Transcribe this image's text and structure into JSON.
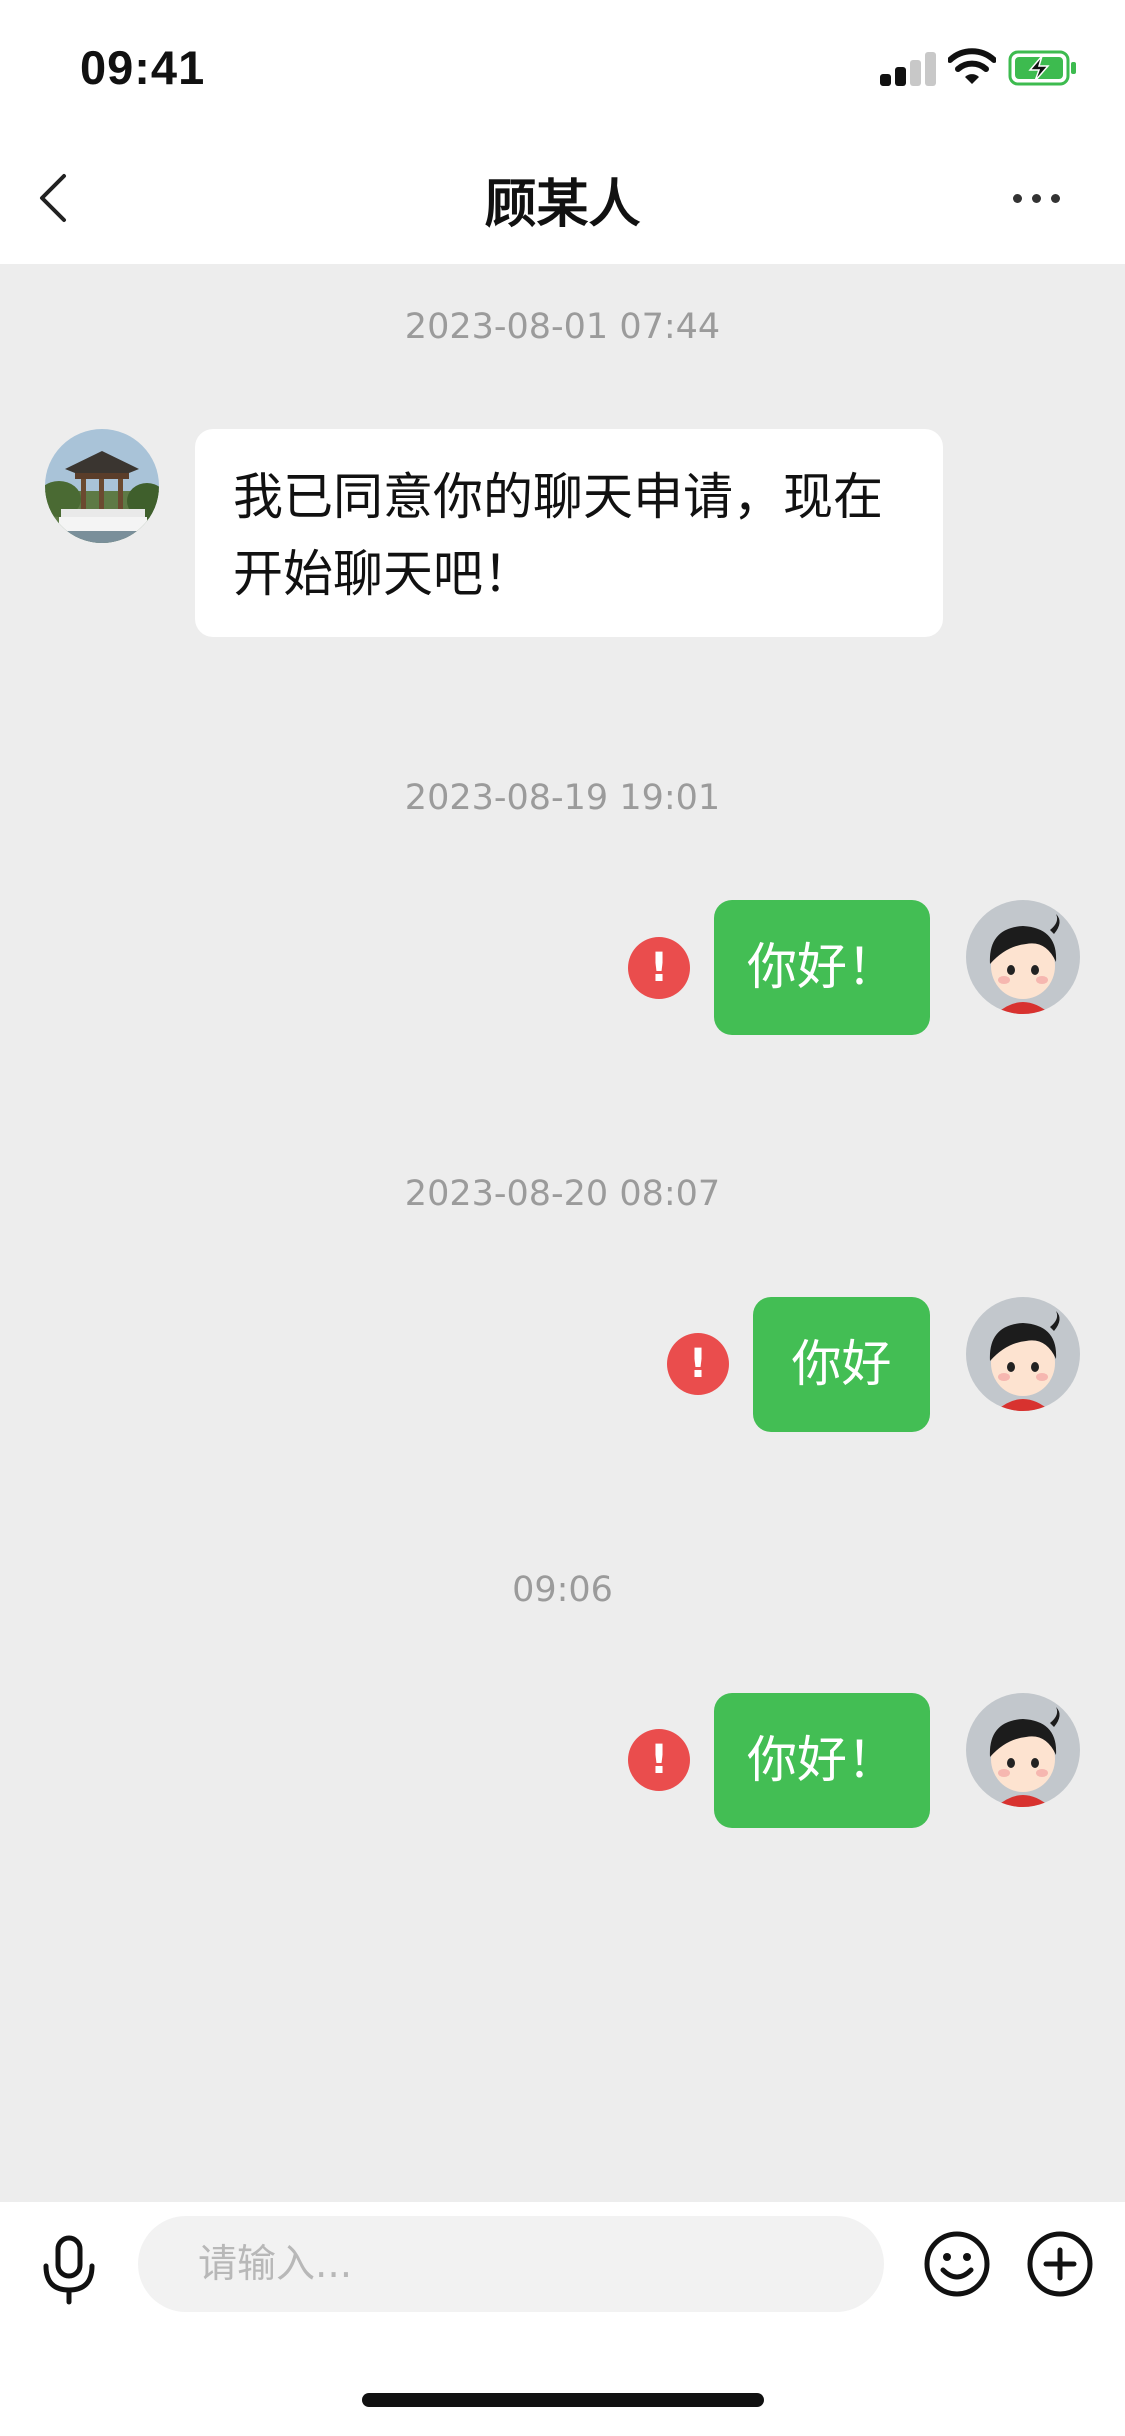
{
  "status_bar": {
    "time": "09:41",
    "battery_color": "#3dbb4f"
  },
  "nav": {
    "title": "顾某人"
  },
  "colors": {
    "sent_bubble": "#43be54",
    "error": "#ea4d4d",
    "background": "#ededed"
  },
  "messages": [
    {
      "timestamp": "2023-08-01 07:44",
      "from": "contact",
      "text": "我已同意你的聊天申请，现在开始聊天吧！",
      "text_line1": "我已同意你的聊天申请，现在",
      "text_line2": "开始聊天吧！"
    },
    {
      "timestamp": "2023-08-19 19:01",
      "from": "me",
      "text": "你好！",
      "send_failed": true
    },
    {
      "timestamp": "2023-08-20 08:07",
      "from": "me",
      "text": "你好",
      "send_failed": true
    },
    {
      "timestamp": "09:06",
      "from": "me",
      "text": "你好！",
      "send_failed": true
    }
  ],
  "error_mark": "!",
  "input": {
    "placeholder": "请输入..."
  },
  "icons": [
    "back-icon",
    "more-icon",
    "mic-icon",
    "emoji-icon",
    "plus-icon",
    "error-icon"
  ]
}
